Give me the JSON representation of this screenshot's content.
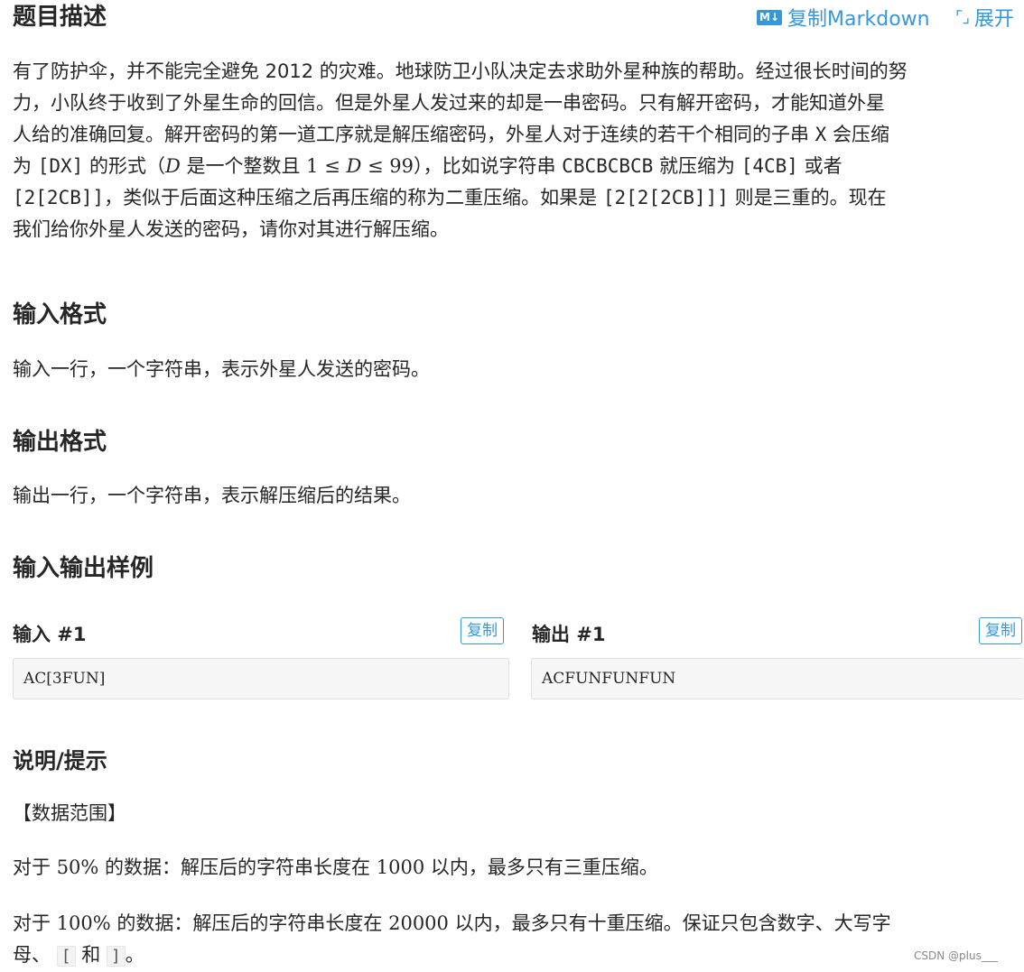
{
  "header": {
    "title": "题目描述",
    "copy_markdown": "复制Markdown",
    "expand": "展开",
    "md_badge": "M↓",
    "icons": {
      "markdown": "markdown-icon",
      "expand": "expand-icon"
    }
  },
  "description": {
    "l1": "有了防护伞，并不能完全避免 2012 的灾难。地球防卫小队决定去求助外星种族的帮助。经过很长时间的努",
    "l2": "力，小队终于收到了外星生命的回信。但是外星人发过来的却是一串密码。只有解开密码，才能知道外星",
    "l3a": "人给的准确回复。解开密码的第一道工序就是解压缩密码，外星人对于连续的若干个相同的子串 ",
    "l3x": "X",
    "l3b": " 会压缩",
    "l4a": "为 ",
    "l4code": "[DX]",
    "l4b": " 的形式（",
    "l4m1": "D",
    "l4b2": " 是一个整数且 ",
    "l4m2": "1 ≤ ",
    "l4m3": "D",
    "l4m4": " ≤ 99",
    "l4c": "），比如说字符串 ",
    "l4code2": "CBCBCBCB",
    "l4d": " 就压缩为 ",
    "l4code3": "[4CB]",
    "l4e": " 或者",
    "l5code1": "[2[2CB]]",
    "l5a": "，类似于后面这种压缩之后再压缩的称为二重压缩。如果是 ",
    "l5code2": "[2[2[2CB]]]",
    "l5b": " 则是三重的。现在",
    "l6": "我们给你外星人发送的密码，请你对其进行解压缩。"
  },
  "input_format": {
    "title": "输入格式",
    "text": "输入一行，一个字符串，表示外星人发送的密码。"
  },
  "output_format": {
    "title": "输出格式",
    "text": "输出一行，一个字符串，表示解压缩后的结果。"
  },
  "samples": {
    "title": "输入输出样例",
    "input_label": "输入 #1",
    "output_label": "输出 #1",
    "copy": "复制",
    "input_value": "AC[3FUN]",
    "output_value": "ACFUNFUNFUN"
  },
  "hint": {
    "title": "说明/提示",
    "range_title": "【数据范围】",
    "l1a": "对于 ",
    "l1m": "50%",
    "l1b": " 的数据：解压后的字符串长度在 ",
    "l1m2": "1000",
    "l1c": " 以内，最多只有三重压缩。",
    "l2a": "对于 ",
    "l2m": "100%",
    "l2b": " 的数据：解压后的字符串长度在 ",
    "l2m2": "20000",
    "l2c": " 以内，最多只有十重压缩。保证只包含数字、大写字",
    "l3a": "母、",
    "l3k1": "[",
    "l3b": " 和 ",
    "l3k2": "]",
    "l3c": "。"
  },
  "watermark": "CSDN @plus___"
}
